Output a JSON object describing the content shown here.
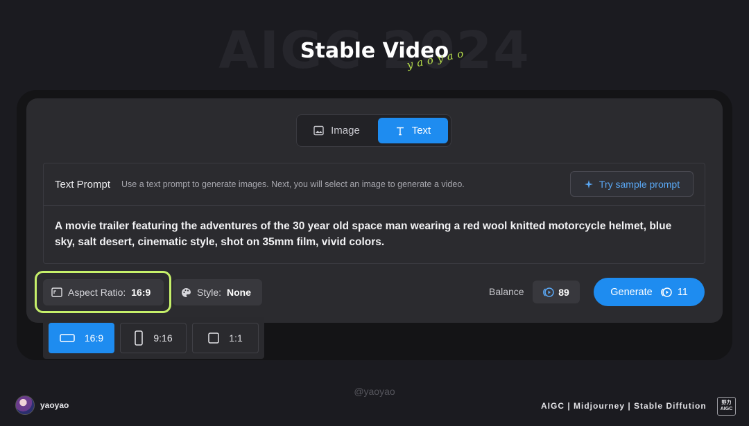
{
  "header": {
    "watermark": "AIGC 2024",
    "title": "Stable Video",
    "signature": "yaoyao"
  },
  "mode_switch": {
    "image_label": "Image",
    "text_label": "Text",
    "active": "Text"
  },
  "prompt": {
    "label": "Text Prompt",
    "hint": "Use a text prompt to generate images. Next, you will select an image to generate a video.",
    "sample_button": "Try sample prompt",
    "value": "A movie trailer featuring the adventures of the 30 year old space man wearing a red wool knitted motorcycle helmet, blue sky, salt desert, cinematic style, shot on 35mm film, vivid colors."
  },
  "controls": {
    "aspect_label": "Aspect Ratio:",
    "aspect_value": "16:9",
    "style_label": "Style:",
    "style_value": "None",
    "balance_label": "Balance",
    "balance_value": "89",
    "generate_label": "Generate",
    "generate_cost": "11"
  },
  "ratio_menu": {
    "options": [
      "16:9",
      "9:16",
      "1:1"
    ],
    "selected": "16:9"
  },
  "footer": {
    "handle": "@yaoyao",
    "author": "yaoyao",
    "tags": "AIGC | Midjourney | Stable Diffution",
    "badge_line1": "野力",
    "badge_line2": "AIGC"
  },
  "colors": {
    "accent": "#1e8cf0",
    "highlight": "#c6f06a",
    "background": "#1b1b20",
    "panel": "#2b2b2f"
  }
}
